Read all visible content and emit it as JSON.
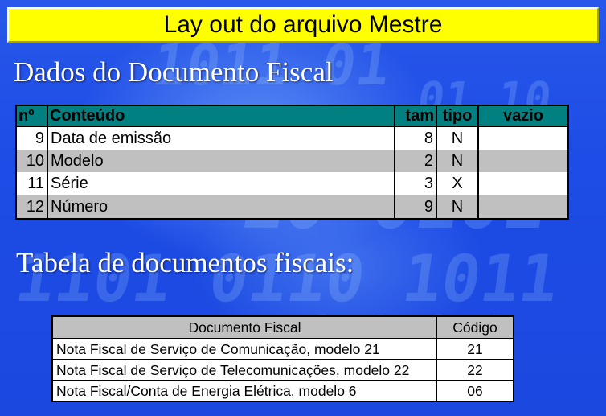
{
  "slide_title": "Lay out do arquivo Mestre",
  "section1_heading": "Dados do Documento Fiscal",
  "table1": {
    "headers": [
      "nº",
      "Conteúdo",
      "tam",
      "tipo",
      "vazio"
    ],
    "rows": [
      {
        "num": "9",
        "conteudo": "Data de emissão",
        "tam": "8",
        "tipo": "N",
        "vazio": ""
      },
      {
        "num": "10",
        "conteudo": "Modelo",
        "tam": "2",
        "tipo": "N",
        "vazio": ""
      },
      {
        "num": "11",
        "conteudo": "Série",
        "tam": "3",
        "tipo": "X",
        "vazio": ""
      },
      {
        "num": "12",
        "conteudo": "Número",
        "tam": "9",
        "tipo": "N",
        "vazio": ""
      }
    ]
  },
  "section2_heading": "Tabela de documentos fiscais:",
  "table2": {
    "headers": [
      "Documento Fiscal",
      "Código"
    ],
    "rows": [
      {
        "documento": "Nota Fiscal de Serviço de Comunicação, modelo 21",
        "codigo": "21"
      },
      {
        "documento": "Nota Fiscal de Serviço de Telecomunicações, modelo 22",
        "codigo": "22"
      },
      {
        "documento": "Nota Fiscal/Conta de Energia Elétrica, modelo 6",
        "codigo": "06"
      }
    ]
  },
  "colors": {
    "background": "#1f4fe0",
    "title_bar": "#ffff00",
    "table_header": "#008080",
    "row_alt": "#c0c0c0"
  }
}
